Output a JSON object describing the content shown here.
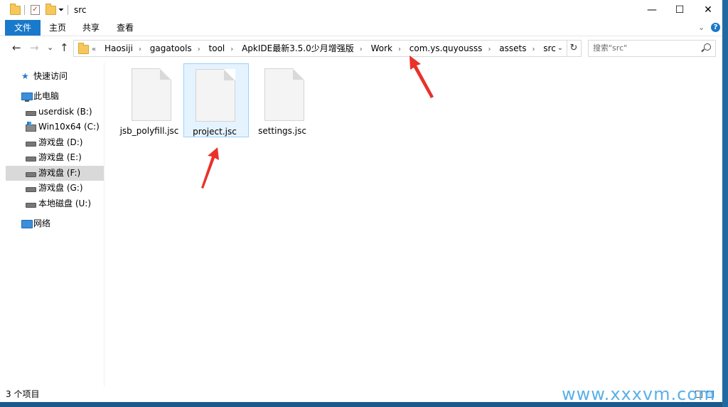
{
  "window": {
    "title": "src",
    "controls": {
      "minimize": "—",
      "maximize": "☐",
      "close": "✕"
    }
  },
  "ribbon": {
    "file_tab": "文件",
    "tabs": [
      "主页",
      "共享",
      "查看"
    ],
    "collapse_glyph": "⌄",
    "help_glyph": "?"
  },
  "nav": {
    "back": "←",
    "forward": "→",
    "recent": "⌄",
    "up": "↑",
    "address_overflow": "«",
    "breadcrumbs": [
      "Haosiji",
      "gagatools",
      "tool",
      "ApkIDE最新3.5.0少月增强版",
      "Work",
      "com.ys.quyousss",
      "assets",
      "src"
    ],
    "chevron": "›",
    "dropdown": "⌄",
    "refresh": "↻",
    "search_placeholder": "搜索\"src\""
  },
  "sidebar": {
    "quick_access": "快速访问",
    "this_pc": "此电脑",
    "drives": [
      {
        "label": "userdisk (B:)",
        "icon": "drive-icon"
      },
      {
        "label": "Win10x64 (C:)",
        "icon": "system-drive-icon"
      },
      {
        "label": "游戏盘 (D:)",
        "icon": "drive-icon"
      },
      {
        "label": "游戏盘 (E:)",
        "icon": "drive-icon"
      },
      {
        "label": "游戏盘 (F:)",
        "icon": "drive-icon",
        "selected": true
      },
      {
        "label": "游戏盘 (G:)",
        "icon": "drive-icon"
      },
      {
        "label": "本地磁盘 (U:)",
        "icon": "drive-icon"
      }
    ],
    "network": "网络"
  },
  "files": [
    {
      "name": "jsb_polyfill.jsc",
      "selected": false
    },
    {
      "name": "project.jsc",
      "selected": true
    },
    {
      "name": "settings.jsc",
      "selected": false
    }
  ],
  "status": {
    "item_count": "3 个项目"
  },
  "watermark": "www.xxxvm.com",
  "colors": {
    "accent": "#1979ca",
    "annotation_arrow": "#e8322a",
    "selection_bg": "#e5f3ff",
    "selection_border": "#99d1ff"
  }
}
